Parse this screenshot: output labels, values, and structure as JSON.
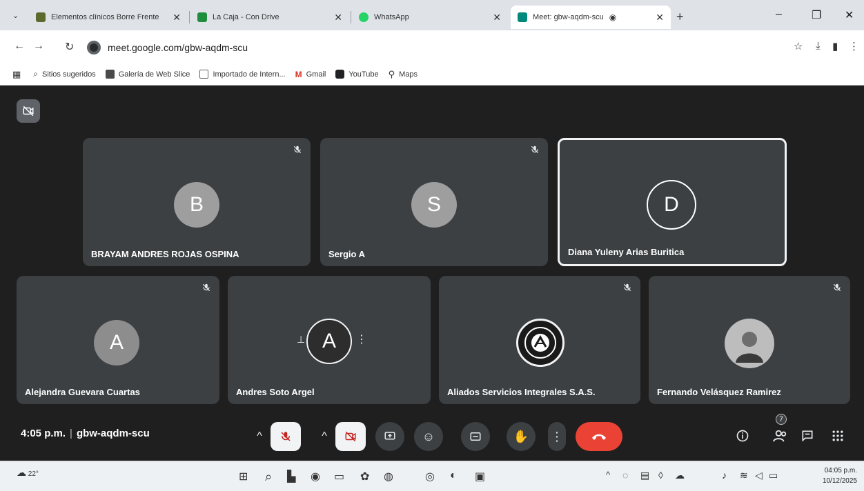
{
  "browser": {
    "tabs": [
      {
        "title": "Elementos clínicos Borre Frente",
        "active": false,
        "favicon_color": "#5b6b2e"
      },
      {
        "title": "La Caja - Con Drive",
        "active": false,
        "favicon_color": "#1e8e3e"
      },
      {
        "title": "WhatsApp",
        "active": false,
        "favicon_color": "#25d366"
      },
      {
        "title": "Meet: gbw-aqdm-scu",
        "active": true,
        "favicon_color": "#00897b"
      }
    ],
    "url": "meet.google.com/gbw-aqdm-scu",
    "bookmarks": [
      {
        "label": "Sitios sugeridos",
        "icon": "search-icon",
        "color": "#5f6368"
      },
      {
        "label": "Galería de Web Slice",
        "icon": "slice-icon",
        "color": "#4a4a4a"
      },
      {
        "label": "Importado de Intern...",
        "icon": "folder-icon",
        "color": "#5f6368"
      },
      {
        "label": "Gmail",
        "icon": "gmail-icon",
        "color": "#d93025"
      },
      {
        "label": "YouTube",
        "icon": "youtube-icon",
        "color": "#202124"
      },
      {
        "label": "Maps",
        "icon": "maps-icon",
        "color": "#202124"
      }
    ]
  },
  "meet": {
    "participants": [
      {
        "name": "BRAYAM ANDRES ROJAS OSPINA",
        "initial": "B",
        "avatar_color": "#9e9e9e",
        "muted": true,
        "speaking": false
      },
      {
        "name": "Sergio A",
        "initial": "S",
        "avatar_color": "#9e9e9e",
        "muted": true,
        "speaking": false
      },
      {
        "name": "Diana Yuleny Arias Buritica",
        "initial": "D",
        "avatar_color": "#3c4043",
        "muted": false,
        "speaking": true
      },
      {
        "name": "Alejandra Guevara Cuartas",
        "initial": "A",
        "avatar_color": "#8d8d8d",
        "muted": true,
        "speaking": false
      },
      {
        "name": "Andres Soto Argel",
        "initial": "A",
        "avatar_color": "#2d2d2d",
        "muted": false,
        "speaking": false
      },
      {
        "name": "Aliados Servicios Integrales S.A.S.",
        "initial": "",
        "avatar_color": "#1a1a1a",
        "muted": true,
        "speaking": false
      },
      {
        "name": "Fernando Velásquez Ramirez",
        "initial": "",
        "avatar_color": "#bdbdbd",
        "muted": true,
        "speaking": false
      }
    ],
    "time": "4:05 p.m.",
    "meeting_code": "gbw-aqdm-scu",
    "people_count": "7",
    "accent_end_call": "#ea4335"
  },
  "taskbar": {
    "temperature": "22°",
    "clock_time": "04:05 p.m.",
    "clock_date": "10/12/2025"
  }
}
